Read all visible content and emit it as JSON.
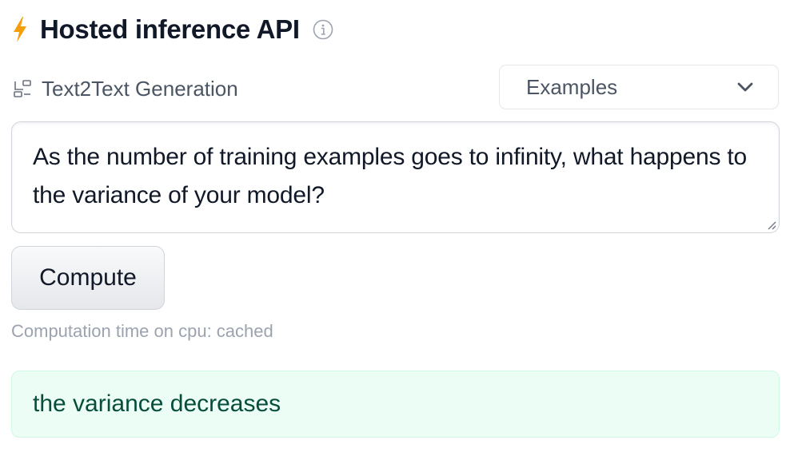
{
  "header": {
    "title": "Hosted inference API",
    "icon": "lightning-bolt-icon",
    "info_icon": "info-icon",
    "accent_color": "#f59e0b"
  },
  "task": {
    "icon": "text2text-task-icon",
    "label": "Text2Text Generation"
  },
  "examples_dropdown": {
    "label": "Examples",
    "icon": "chevron-down-icon"
  },
  "input": {
    "value": "As the number of training examples goes to infinity, what happens to the variance of your model?"
  },
  "compute_button": {
    "label": "Compute"
  },
  "computation_time": "Computation time on cpu: cached",
  "output": {
    "text": "the variance decreases",
    "background_color": "#ecfdf5"
  }
}
